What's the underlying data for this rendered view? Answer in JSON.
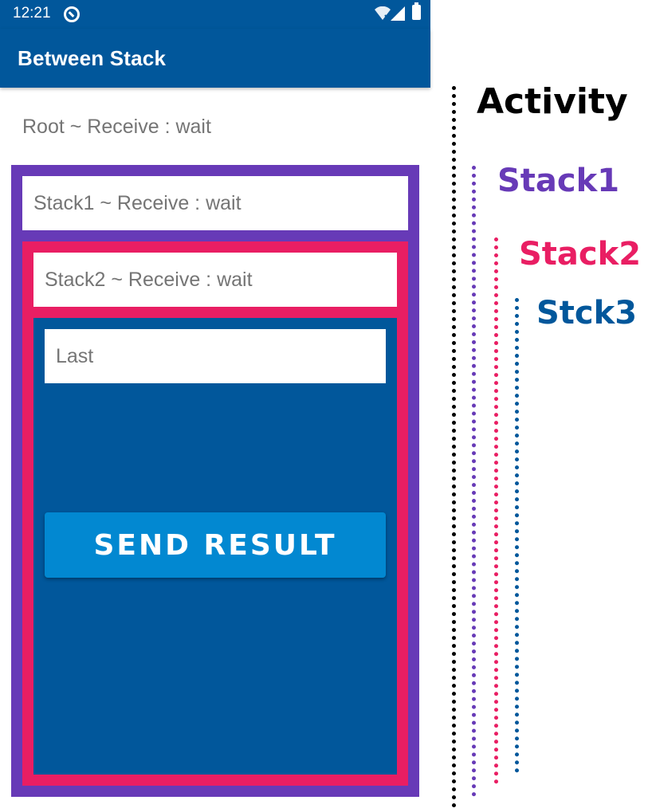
{
  "status_bar": {
    "time": "12:21",
    "icons": [
      "app-notification-icon",
      "wifi-icon",
      "signal-icon",
      "battery-icon"
    ]
  },
  "app_bar": {
    "title": "Between Stack"
  },
  "root": {
    "status_text": "Root ~ Receive : wait"
  },
  "stack1": {
    "status_text": "Stack1 ~ Receive : wait"
  },
  "stack2": {
    "status_text": "Stack2 ~ Receive : wait"
  },
  "stack3": {
    "input_value": "Last",
    "send_button_label": "SEND RESULT"
  },
  "annotation": {
    "activity_label": "Activity",
    "stack1_label": "Stack1",
    "stack2_label": "Stack2",
    "stack3_label": "Stck3"
  },
  "colors": {
    "primary": "#01579b",
    "stack1": "#673ab7",
    "stack2": "#e91e63",
    "stack3": "#01579b",
    "button": "#0288d1",
    "activity": "#000000"
  }
}
